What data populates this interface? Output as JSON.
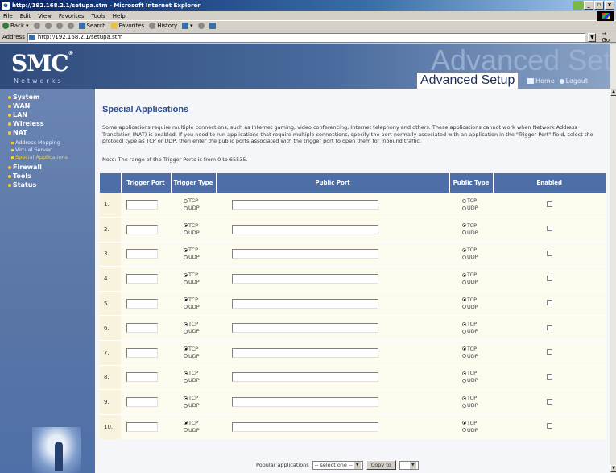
{
  "window": {
    "title": "http://192.168.2.1/setupa.stm - Microsoft Internet Explorer",
    "buttons": {
      "minimize": "_",
      "maximize": "▫",
      "close": "x"
    }
  },
  "menubar": [
    "File",
    "Edit",
    "View",
    "Favorites",
    "Tools",
    "Help"
  ],
  "toolbar": {
    "back": "Back",
    "search": "Search",
    "favorites": "Favorites",
    "history": "History"
  },
  "address": {
    "label": "Address",
    "url": "http://192.168.2.1/setupa.stm",
    "go": "Go"
  },
  "header": {
    "logo": "SMC",
    "logo_mark": "®",
    "networks": "Networks",
    "big_title": "Advanced Setup",
    "title": "Advanced Setup",
    "home": "Home",
    "logout": "Logout"
  },
  "sidebar": {
    "items": [
      {
        "label": "System"
      },
      {
        "label": "WAN"
      },
      {
        "label": "LAN"
      },
      {
        "label": "Wireless"
      },
      {
        "label": "NAT"
      },
      {
        "label": "Firewall"
      },
      {
        "label": "Tools"
      },
      {
        "label": "Status"
      }
    ],
    "nat_sub": [
      {
        "label": "Address Mapping",
        "active": false
      },
      {
        "label": "Virtual Server",
        "active": false
      },
      {
        "label": "Special Applications",
        "active": true
      }
    ]
  },
  "main": {
    "heading": "Special Applications",
    "description": "Some applications require multiple connections, such as Internet gaming, video conferencing, Internet telephony and others. These applications cannot work when Network Address Translation (NAT) is enabled. If you need to run applications that require multiple connections, specify the port normally associated with an application in the \"Trigger Port\" field, select the protocol type as TCP or UDP, then enter the public ports associated with the trigger port to open them for inbound traffic.",
    "note": "Note: The range of the Trigger Ports is from 0 to 65535.",
    "columns": {
      "trigger_port": "Trigger Port",
      "trigger_type": "Trigger Type",
      "public_port": "Public Port",
      "public_type": "Public Type",
      "enabled": "Enabled"
    },
    "radio_tcp": "TCP",
    "radio_udp": "UDP",
    "rows": [
      {
        "n": "1."
      },
      {
        "n": "2."
      },
      {
        "n": "3."
      },
      {
        "n": "4."
      },
      {
        "n": "5."
      },
      {
        "n": "6."
      },
      {
        "n": "7."
      },
      {
        "n": "8."
      },
      {
        "n": "9."
      },
      {
        "n": "10."
      }
    ],
    "popular_label": "Popular applications",
    "popular_select": "-- select one --",
    "copy_to": "Copy to",
    "copy_select": ""
  }
}
